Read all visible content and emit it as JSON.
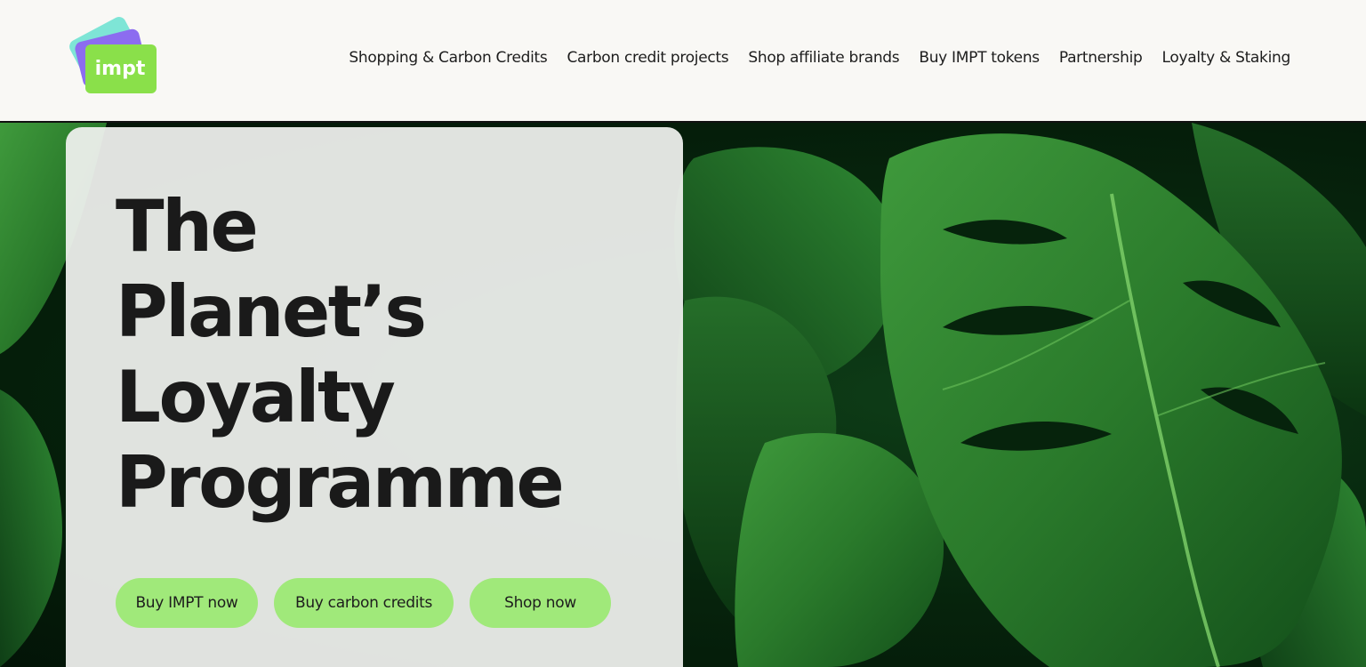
{
  "brand": {
    "logo_text": "impt",
    "logo_icon": "stacked-cards-logo",
    "colors": {
      "green": "#8ae04a",
      "purple": "#8c6cf0",
      "teal": "#7ee5d6"
    }
  },
  "nav": {
    "items": [
      {
        "label": "Shopping & Carbon Credits"
      },
      {
        "label": "Carbon credit projects"
      },
      {
        "label": "Shop affiliate brands"
      },
      {
        "label": "Buy IMPT tokens"
      },
      {
        "label": "Partnership"
      },
      {
        "label": "Loyalty & Staking"
      }
    ]
  },
  "hero": {
    "title_lines": [
      "The",
      "Planet’s",
      "Loyalty",
      "Programme"
    ],
    "buttons": [
      {
        "label": "Buy IMPT now"
      },
      {
        "label": "Buy carbon credits"
      },
      {
        "label": "Shop now"
      }
    ],
    "background": "monstera-leaves-photo"
  },
  "colors": {
    "button_bg": "#a0e97a",
    "header_bg": "#f9f8f5",
    "card_bg": "#f1f2f0",
    "text": "#1a1a1a"
  }
}
